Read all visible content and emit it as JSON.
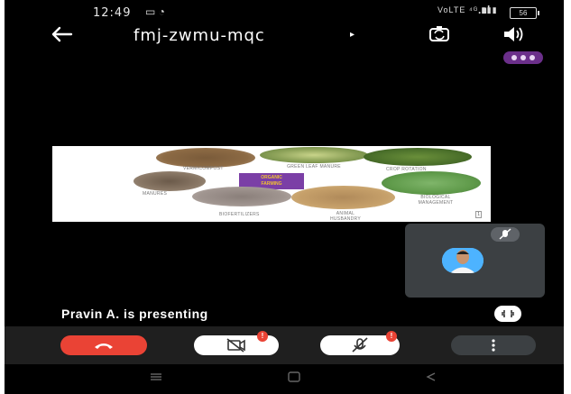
{
  "status_bar": {
    "time": "12:49",
    "left_icons": "▭ ◔",
    "network": "VoLTE ⁴ᴳ ▮▮▮",
    "signal": ".ııl",
    "battery": "56"
  },
  "app_bar": {
    "meeting_code": "fmj-zwmu-mqc",
    "caret": "▸",
    "back_icon": "arrow-left",
    "camera_switch_icon": "camera-switch",
    "speaker_icon": "speaker"
  },
  "slide": {
    "center_title": "ORGANIC\nFARMING",
    "labels": {
      "vermicompost": "VERMICOMPOST",
      "green_leaf": "GREEN LEAF MANURE",
      "crop_rotation": "CROP ROTATION",
      "manures": "MANURES",
      "biofertilizers": "BIOFERTILIZERS",
      "animal_husbandry": "ANIMAL HUSBANDRY",
      "biological": "BIOLOGICAL MANAGEMENT"
    },
    "page": "1"
  },
  "presenter": {
    "text": "Pravin A. is presenting"
  },
  "controls": {
    "end_call_icon": "phone-hangup",
    "camera_icon": "camera-off",
    "camera_badge": "!",
    "mic_icon": "mic-off",
    "mic_badge": "!",
    "more_icon": "more-vertical"
  },
  "colors": {
    "end_call": "#ea4335",
    "purple_menu": "#6b2f8a",
    "self_view": "#3c4043"
  }
}
